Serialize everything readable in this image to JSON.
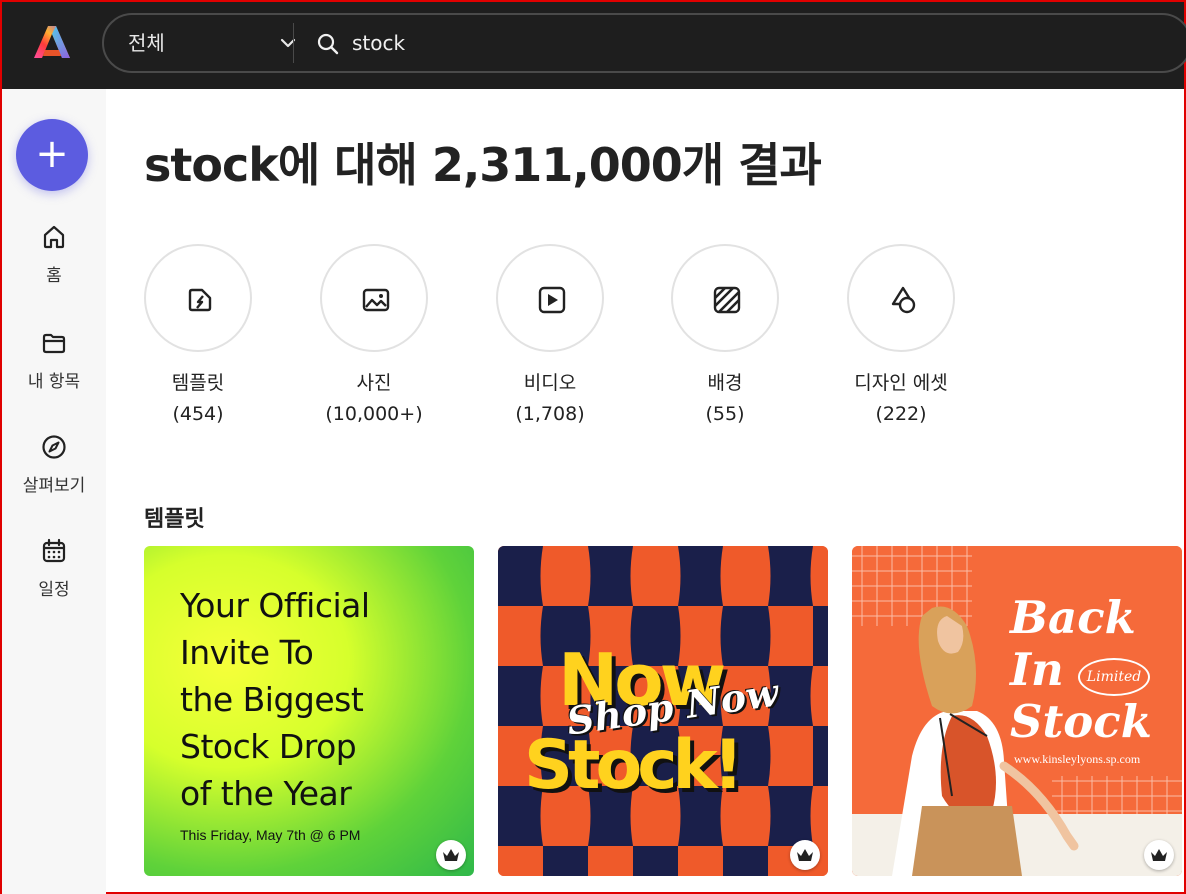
{
  "topbar": {
    "scope_label": "전체",
    "search_query": "stock"
  },
  "sidebar": {
    "create_label": "+",
    "items": [
      {
        "label": "홈",
        "icon": "home-icon"
      },
      {
        "label": "내 항목",
        "icon": "folder-icon"
      },
      {
        "label": "살펴보기",
        "icon": "compass-icon"
      },
      {
        "label": "일정",
        "icon": "calendar-icon"
      }
    ]
  },
  "main": {
    "heading": "stock에 대해 2,311,000개 결과",
    "categories": [
      {
        "name": "템플릿",
        "count": "(454)",
        "icon": "template-icon"
      },
      {
        "name": "사진",
        "count": "(10,000+)",
        "icon": "photo-icon"
      },
      {
        "name": "비디오",
        "count": "(1,708)",
        "icon": "video-icon"
      },
      {
        "name": "배경",
        "count": "(55)",
        "icon": "background-icon"
      },
      {
        "name": "디자인 에셋",
        "count": "(222)",
        "icon": "design-asset-icon"
      }
    ],
    "section_title": "템플릿",
    "templates": [
      {
        "lines": [
          "Your Official",
          "Invite To",
          "the Biggest",
          "Stock Drop",
          "of the Year"
        ],
        "subtitle": "This Friday, May 7th @ 6 PM"
      },
      {
        "word1": "Now",
        "word2": "Stock!",
        "script": "Shop Now"
      },
      {
        "title_lines": [
          "Back",
          "In",
          "Stock"
        ],
        "badge": "Limited",
        "url": "www.kinsleylyons.sp.com"
      }
    ]
  },
  "colors": {
    "topbar_bg": "#1e1e1e",
    "accent": "#5c5ce0",
    "sidebar_bg": "#f7f7f7",
    "orange": "#ef5a2a",
    "navy": "#1a1f4a",
    "yellow": "#ffd21e"
  }
}
